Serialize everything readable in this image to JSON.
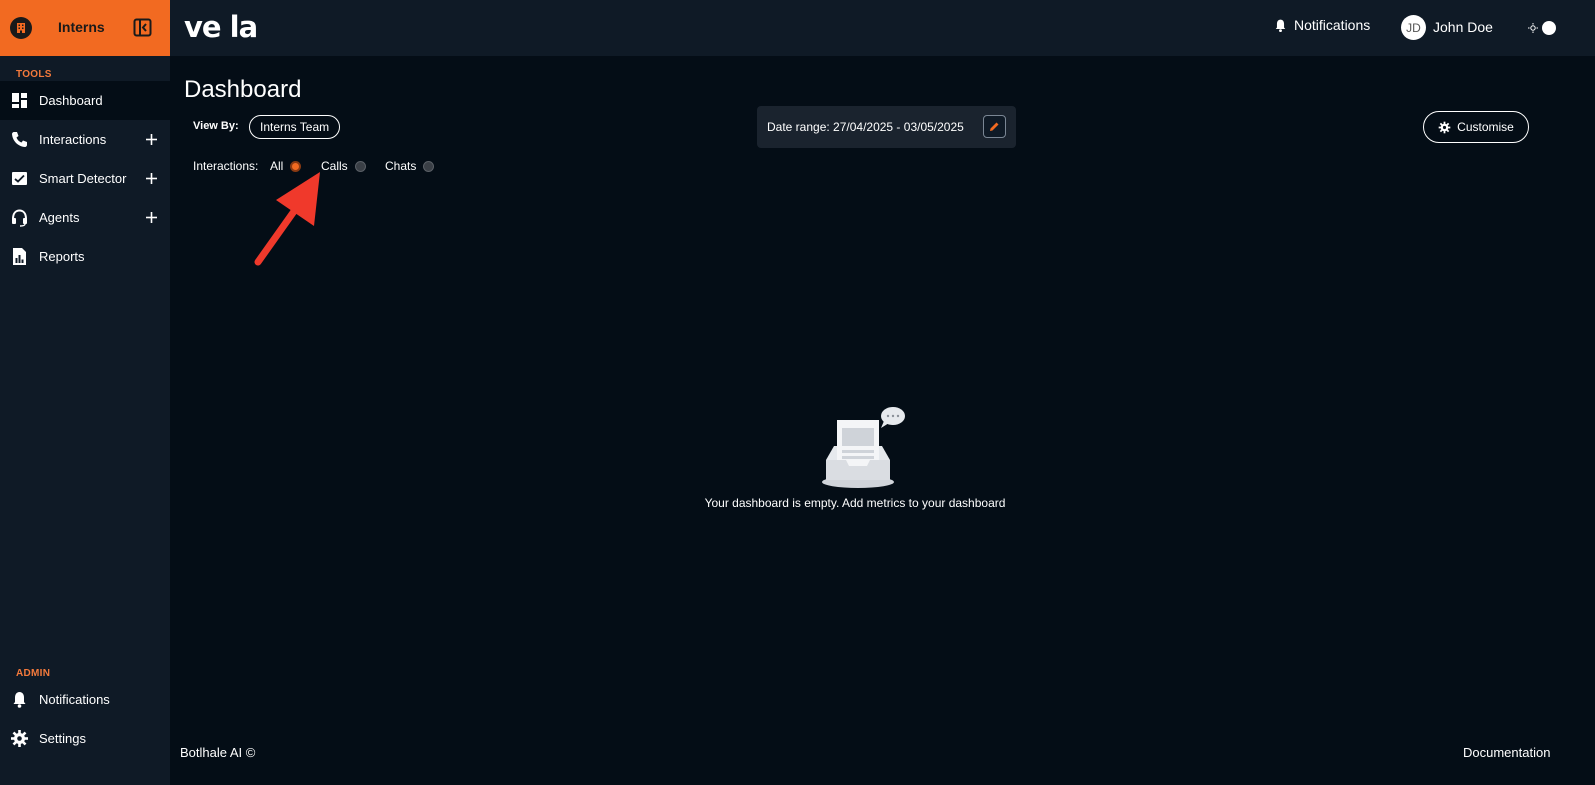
{
  "org": {
    "name": "Interns",
    "icon": "building-icon",
    "brand_color": "#f26a21"
  },
  "sidebar": {
    "tools_label": "TOOLS",
    "admin_label": "ADMIN",
    "items": [
      {
        "label": "Dashboard",
        "icon": "dashboard-icon",
        "has_plus": false,
        "active": true
      },
      {
        "label": "Interactions",
        "icon": "phone-icon",
        "has_plus": true
      },
      {
        "label": "Smart Detector",
        "icon": "chart-check-icon",
        "has_plus": true
      },
      {
        "label": "Agents",
        "icon": "headset-icon",
        "has_plus": true
      },
      {
        "label": "Reports",
        "icon": "report-icon",
        "has_plus": false
      }
    ],
    "admin_items": [
      {
        "label": "Notifications",
        "icon": "bell-icon"
      },
      {
        "label": "Settings",
        "icon": "gear-icon"
      }
    ]
  },
  "topbar": {
    "logo": "ve la",
    "notifications_label": "Notifications",
    "avatar_initials": "JD",
    "user_name": "John Doe"
  },
  "main": {
    "title": "Dashboard",
    "view_by_label": "View By:",
    "team": "Interns Team",
    "date_range": "Date range: 27/04/2025 - 03/05/2025",
    "customise_label": "Customise",
    "filter_label": "Interactions:",
    "filter_options": [
      {
        "label": "All",
        "checked": true
      },
      {
        "label": "Calls",
        "checked": false
      },
      {
        "label": "Chats",
        "checked": false
      }
    ],
    "empty_message": "Your dashboard is empty. Add metrics to your dashboard"
  },
  "footer": {
    "copyright": "Botlhale AI ©",
    "documentation": "Documentation"
  }
}
